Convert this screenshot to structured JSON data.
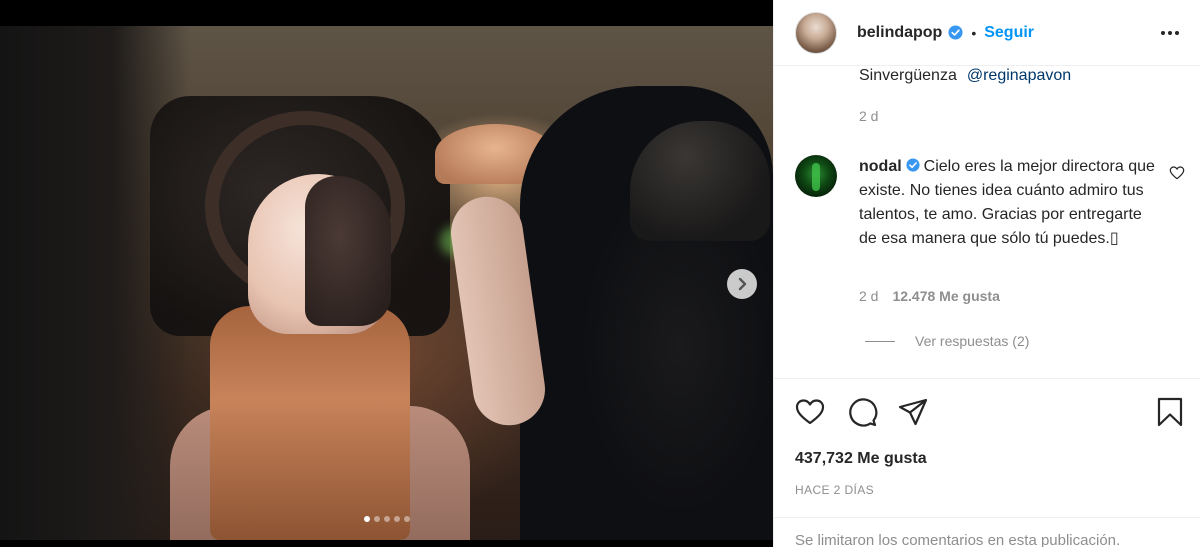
{
  "post": {
    "username": "belindapop",
    "separator": "•",
    "follow_label": "Seguir",
    "caption_tail_text": "Sinvergüenza",
    "caption_mention": "@reginapavon",
    "caption_time": "2 d",
    "carousel": {
      "count": 5,
      "active_index": 0
    }
  },
  "comment": {
    "username": "nodal",
    "text": "Cielo eres la mejor directora que existe. No tienes idea cuánto admiro tus talentos, te amo. Gracias por entregarte de esa manera que sólo tú puedes.▯",
    "time": "2 d",
    "likes": "12.478 Me gusta",
    "view_replies": "Ver respuestas (2)"
  },
  "stats": {
    "likes_label": "437,732 Me gusta",
    "timestamp": "HACE 2 DÍAS"
  },
  "footer": {
    "comments_limited": "Se limitaron los comentarios en esta publicación."
  },
  "icons": {
    "verified": "verified-badge-icon",
    "more": "more-options-icon",
    "heart": "heart-icon",
    "comment": "comment-icon",
    "share": "share-icon",
    "save": "bookmark-icon",
    "next": "chevron-right-icon"
  },
  "colors": {
    "link_blue": "#0095f6",
    "mention_blue": "#00376b",
    "verified_blue": "#3897f0",
    "muted_gray": "#8e8e8e",
    "text_dark": "#262626"
  }
}
